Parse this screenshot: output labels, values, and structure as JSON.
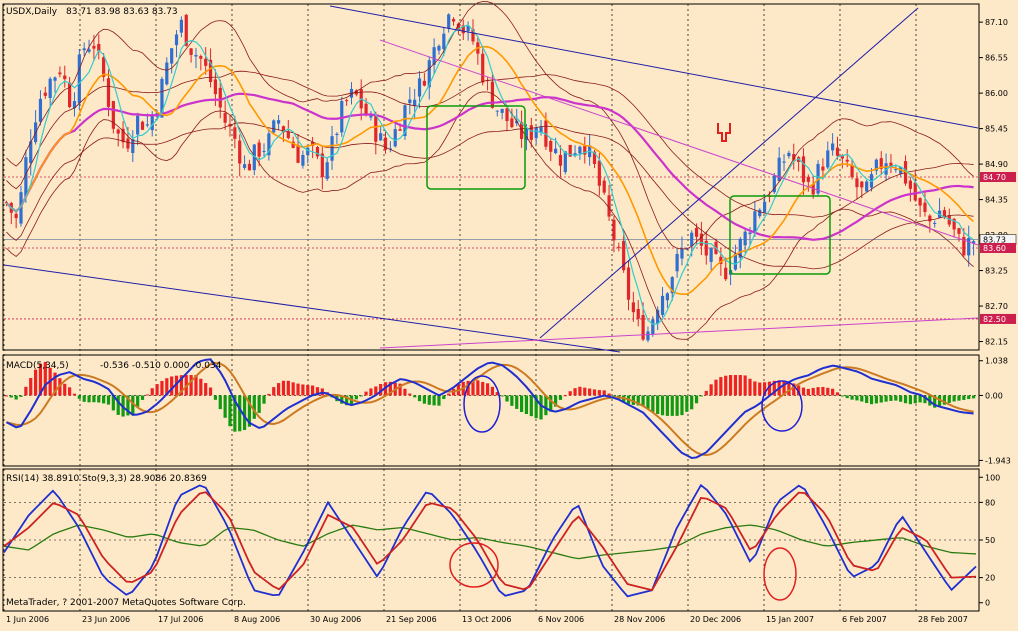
{
  "header": {
    "symbol": "USDX,Daily",
    "ohlc": "83.71 83.98 83.63 83.73",
    "copyright": "MetaTrader, ? 2001-2007 MetaQuotes Software Corp."
  },
  "colors": {
    "background": "#fde9c8",
    "grid": "#000000",
    "up_candle": "#2f6fd0",
    "down_candle": "#e0262a",
    "ma_fast": "#33cccc",
    "ma_mid": "#ff9900",
    "ma_slow": "#cc33cc",
    "bands": "#8b1a1a",
    "trendline_blue": "#1f1fa8",
    "trendline_magenta": "#cc44cc",
    "annotation_green": "#0b9a0b",
    "annotation_blue": "#1f1fd6",
    "annotation_red": "#e01f1f",
    "macd_up": "#ee2222",
    "macd_down": "#119911",
    "macd_line": "#1f2fd0",
    "signal_line": "#cc7a22",
    "rsi_line": "#2a7a0f",
    "stoch_k": "#1f2fd0",
    "stoch_d": "#cc2222"
  },
  "chart_data": [
    {
      "type": "candlestick",
      "panel": "price",
      "title": "USDX,Daily",
      "ylim": [
        82.05,
        87.35
      ],
      "y_ticks": [
        "87.10",
        "86.55",
        "86.00",
        "85.45",
        "84.90",
        "84.35",
        "83.80",
        "83.25",
        "82.70",
        "82.15"
      ],
      "price_labels": [
        {
          "value": 84.7,
          "text": "84.70",
          "color": "#cc1f4d"
        },
        {
          "value": 83.73,
          "text": "83.73",
          "color": "#000000"
        },
        {
          "value": 83.6,
          "text": "83.60",
          "color": "#cc1f4d"
        },
        {
          "value": 82.5,
          "text": "82.50",
          "color": "#cc1f4d"
        }
      ],
      "x_labels": [
        "1 Jun 2006",
        "23 Jun 2006",
        "17 Jul 2006",
        "8 Aug 2006",
        "30 Aug 2006",
        "21 Sep 2006",
        "13 Oct 2006",
        "6 Nov 2006",
        "28 Nov 2006",
        "20 Dec 2006",
        "15 Jan 2007",
        "6 Feb 2007",
        "28 Feb 2007"
      ],
      "close_path": [
        84.3,
        84.0,
        85.2,
        85.9,
        86.2,
        86.4,
        85.8,
        86.7,
        86.8,
        86.2,
        85.4,
        85.2,
        85.6,
        85.5,
        85.9,
        86.6,
        87.1,
        86.7,
        86.5,
        86.1,
        85.6,
        85.3,
        84.8,
        85.1,
        85.2,
        85.6,
        85.3,
        85.0,
        85.1,
        84.8,
        85.2,
        85.8,
        86.0,
        85.7,
        85.4,
        85.1,
        85.5,
        85.9,
        86.1,
        86.5,
        87.0,
        87.3,
        87.0,
        86.8,
        86.2,
        85.8,
        85.6,
        85.4,
        85.3,
        85.6,
        85.2,
        85.0,
        85.1,
        85.3,
        84.9,
        84.3,
        83.7,
        83.0,
        82.4,
        82.3,
        82.8,
        83.1,
        83.5,
        83.8,
        83.6,
        83.4,
        83.2,
        83.5,
        83.8,
        84.2,
        84.4,
        84.8,
        85.1,
        84.8,
        84.5,
        84.9,
        85.1,
        84.9,
        84.6,
        84.4,
        84.8,
        85.0,
        84.9,
        84.6,
        84.2,
        84.0,
        84.2,
        83.9,
        83.6,
        83.73
      ],
      "indicators": [
        "fast moving average",
        "mid moving average",
        "slow moving average",
        "Bollinger-type envelopes"
      ]
    },
    {
      "type": "histogram+line",
      "panel": "macd",
      "title": "MACD(5,34,5)",
      "values_text": "-0.536 -0.510 0.000 -0.034",
      "ylim": [
        -2.05,
        1.15
      ],
      "y_ticks": [
        "1.038",
        "0.00",
        "-1.943"
      ],
      "macd_path": [
        -0.8,
        -1.0,
        -0.4,
        0.3,
        0.6,
        0.7,
        0.5,
        0.4,
        0.2,
        -0.3,
        -0.6,
        -0.5,
        -0.2,
        0.2,
        0.6,
        1.0,
        1.1,
        0.6,
        -0.2,
        -0.8,
        -1.0,
        -0.7,
        -0.4,
        -0.2,
        0.0,
        0.1,
        -0.1,
        -0.3,
        -0.2,
        0.0,
        0.3,
        0.5,
        0.4,
        0.2,
        0.0,
        0.2,
        0.5,
        0.8,
        1.0,
        0.9,
        0.6,
        0.2,
        -0.3,
        -0.5,
        -0.4,
        -0.2,
        -0.1,
        0.0,
        -0.1,
        -0.3,
        -0.5,
        -0.9,
        -1.3,
        -1.7,
        -1.9,
        -1.7,
        -1.3,
        -0.9,
        -0.5,
        -0.3,
        0.0,
        0.3,
        0.5,
        0.6,
        0.8,
        0.9,
        0.8,
        0.7,
        0.5,
        0.4,
        0.3,
        0.1,
        0.0,
        -0.3,
        -0.4,
        -0.5,
        -0.54
      ]
    },
    {
      "type": "line",
      "panel": "oscillators",
      "title": "RSI(14) 38.8910 Sto(9,3,3) 28.9086 20.8369",
      "ylim": [
        -5,
        105
      ],
      "y_ticks": [
        "100",
        "80",
        "50",
        "20",
        "0"
      ],
      "series": [
        {
          "name": "RSI(14) 38.8910",
          "role": "rsi",
          "values": [
            45,
            42,
            55,
            62,
            58,
            52,
            55,
            48,
            45,
            60,
            58,
            50,
            45,
            55,
            62,
            58,
            60,
            55,
            50,
            52,
            48,
            45,
            40,
            35,
            38,
            40,
            42,
            45,
            55,
            60,
            62,
            58,
            50,
            45,
            48,
            50,
            52,
            45,
            40,
            38.9
          ]
        },
        {
          "name": "Sto(9,3,3) 28.9086",
          "role": "k",
          "values": [
            40,
            70,
            90,
            60,
            20,
            5,
            30,
            85,
            95,
            60,
            10,
            5,
            40,
            80,
            50,
            20,
            60,
            90,
            70,
            40,
            5,
            10,
            50,
            80,
            30,
            5,
            10,
            60,
            95,
            70,
            30,
            80,
            95,
            60,
            20,
            30,
            70,
            40,
            10,
            28.9
          ]
        },
        {
          "name": "20.8369",
          "role": "d",
          "values": [
            45,
            60,
            80,
            70,
            35,
            15,
            25,
            70,
            90,
            70,
            25,
            10,
            30,
            70,
            60,
            30,
            50,
            80,
            75,
            50,
            15,
            10,
            40,
            70,
            45,
            15,
            10,
            45,
            85,
            75,
            40,
            70,
            90,
            70,
            30,
            25,
            60,
            50,
            20,
            20.8
          ]
        }
      ]
    }
  ]
}
